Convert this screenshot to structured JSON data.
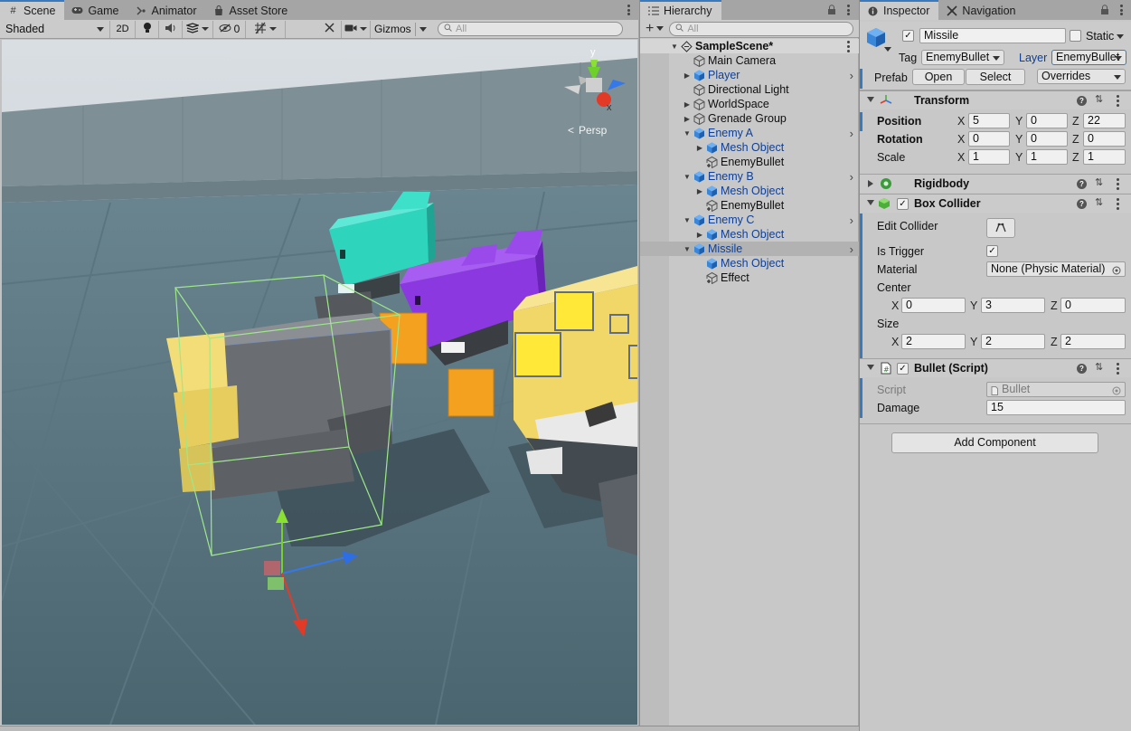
{
  "scene_tabs": {
    "scene": "Scene",
    "game": "Game",
    "animator": "Animator",
    "asset_store": "Asset Store"
  },
  "scene_toolbar": {
    "shading_mode": "Shaded",
    "mode_2d": "2D",
    "hidden_count": "0",
    "gizmos": "Gizmos",
    "search_placeholder": "All"
  },
  "viewport": {
    "projection": "Persp",
    "axis_y": "y",
    "axis_x": "x"
  },
  "hierarchy": {
    "tab": "Hierarchy",
    "search_placeholder": "All",
    "items": [
      {
        "label": "SampleScene*",
        "depth": 0,
        "expanded": true,
        "kind": "scene"
      },
      {
        "label": "Main Camera",
        "depth": 1,
        "kind": "object"
      },
      {
        "label": "Player",
        "depth": 1,
        "kind": "prefab",
        "collapsed": true
      },
      {
        "label": "Directional Light",
        "depth": 1,
        "kind": "object"
      },
      {
        "label": "WorldSpace",
        "depth": 1,
        "kind": "object",
        "collapsed": true
      },
      {
        "label": "Grenade Group",
        "depth": 1,
        "kind": "object",
        "collapsed": true
      },
      {
        "label": "Enemy A",
        "depth": 1,
        "kind": "prefab",
        "expanded": true
      },
      {
        "label": "Mesh Object",
        "depth": 2,
        "kind": "prefab",
        "collapsed": true
      },
      {
        "label": "EnemyBullet",
        "depth": 2,
        "kind": "object-added"
      },
      {
        "label": "Enemy B",
        "depth": 1,
        "kind": "prefab",
        "expanded": true
      },
      {
        "label": "Mesh Object",
        "depth": 2,
        "kind": "prefab",
        "collapsed": true
      },
      {
        "label": "EnemyBullet",
        "depth": 2,
        "kind": "object-added"
      },
      {
        "label": "Enemy C",
        "depth": 1,
        "kind": "prefab",
        "expanded": true
      },
      {
        "label": "Mesh Object",
        "depth": 2,
        "kind": "prefab",
        "collapsed": true
      },
      {
        "label": "Missile",
        "depth": 1,
        "kind": "prefab",
        "expanded": true,
        "selected": true
      },
      {
        "label": "Mesh Object",
        "depth": 2,
        "kind": "prefab"
      },
      {
        "label": "Effect",
        "depth": 2,
        "kind": "object-added"
      }
    ]
  },
  "inspector": {
    "tab": "Inspector",
    "nav_tab": "Navigation",
    "object_name": "Missile",
    "static_label": "Static",
    "tag_label": "Tag",
    "tag_value": "EnemyBullet",
    "layer_label": "Layer",
    "layer_value": "EnemyBullet",
    "prefab_label": "Prefab",
    "prefab_open": "Open",
    "prefab_select": "Select",
    "prefab_overrides": "Overrides",
    "transform": {
      "title": "Transform",
      "position_label": "Position",
      "rotation_label": "Rotation",
      "scale_label": "Scale",
      "position": {
        "x": "5",
        "y": "0",
        "z": "22"
      },
      "rotation": {
        "x": "0",
        "y": "0",
        "z": "0"
      },
      "scale": {
        "x": "1",
        "y": "1",
        "z": "1"
      }
    },
    "rigidbody": {
      "title": "Rigidbody"
    },
    "box_collider": {
      "title": "Box Collider",
      "edit_collider": "Edit Collider",
      "is_trigger": "Is Trigger",
      "material_label": "Material",
      "material_value": "None (Physic Material)",
      "center_label": "Center",
      "center": {
        "x": "0",
        "y": "3",
        "z": "0"
      },
      "size_label": "Size",
      "size": {
        "x": "2",
        "y": "2",
        "z": "2"
      }
    },
    "bullet_script": {
      "title": "Bullet (Script)",
      "script_label": "Script",
      "script_value": "Bullet",
      "damage_label": "Damage",
      "damage_value": "15"
    },
    "add_component": "Add Component"
  },
  "axis_letters": {
    "x": "X",
    "y": "Y",
    "z": "Z"
  },
  "colors": {
    "accent": "#3a79bb",
    "prefab_blue": "#0f3f95",
    "enemy_cyan": "#33d6c0",
    "enemy_purple": "#8e3ae0",
    "enemy_yellow": "#f2d86a",
    "bullet_orange": "#f3a11f"
  }
}
